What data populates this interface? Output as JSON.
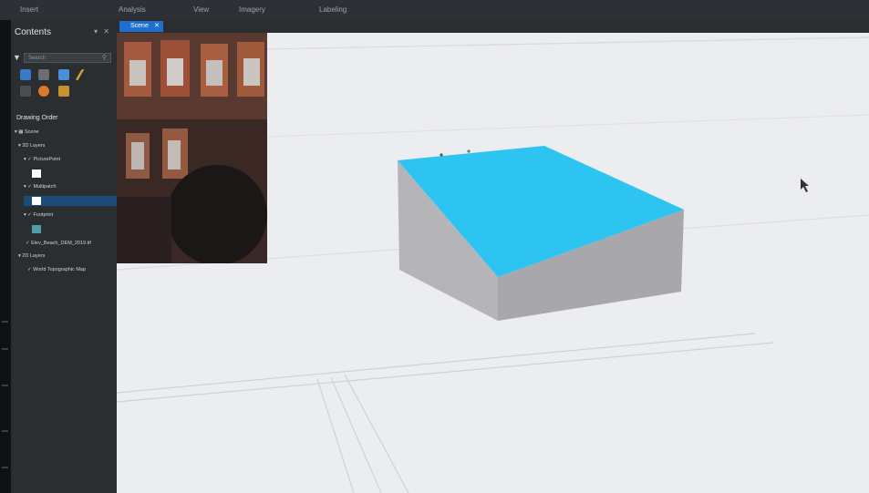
{
  "ribbon": {
    "tabs": [
      "Insert",
      "Analysis",
      "View",
      "Imagery",
      "Labeling"
    ]
  },
  "contents_pane": {
    "title": "Contents",
    "pane_controls": "▾ ✕",
    "search_placeholder": "Search",
    "drawing_order_label": "Drawing Order",
    "tree": {
      "scene": "Scene",
      "layers_3d": "3D Layers",
      "pictures_point": "PicturePoint",
      "multipatch": "Multipatch",
      "footprint": "Footprint",
      "elevation_layer": "Elev_Beach_DEM_2019.tif",
      "layers_2d": "2D Layers",
      "basemap": "World Topographic Map"
    }
  },
  "view": {
    "tab_label": "Scene",
    "tab_close": "✕"
  },
  "colors": {
    "roof": "#2ec4f2",
    "wall_front": "#a9a9ae",
    "wall_side": "#bcbcc1",
    "accent_tab": "#1f6fd0",
    "panel_bg": "#2b2e31"
  },
  "icons": [
    "search-icon",
    "filter-icon",
    "list-by-drawing-order-icon",
    "list-by-source-icon",
    "list-by-selection-icon",
    "list-by-editing-icon",
    "list-by-snapping-icon",
    "list-by-labeling-icon",
    "list-by-perspective-icon",
    "close-icon",
    "pin-icon"
  ]
}
